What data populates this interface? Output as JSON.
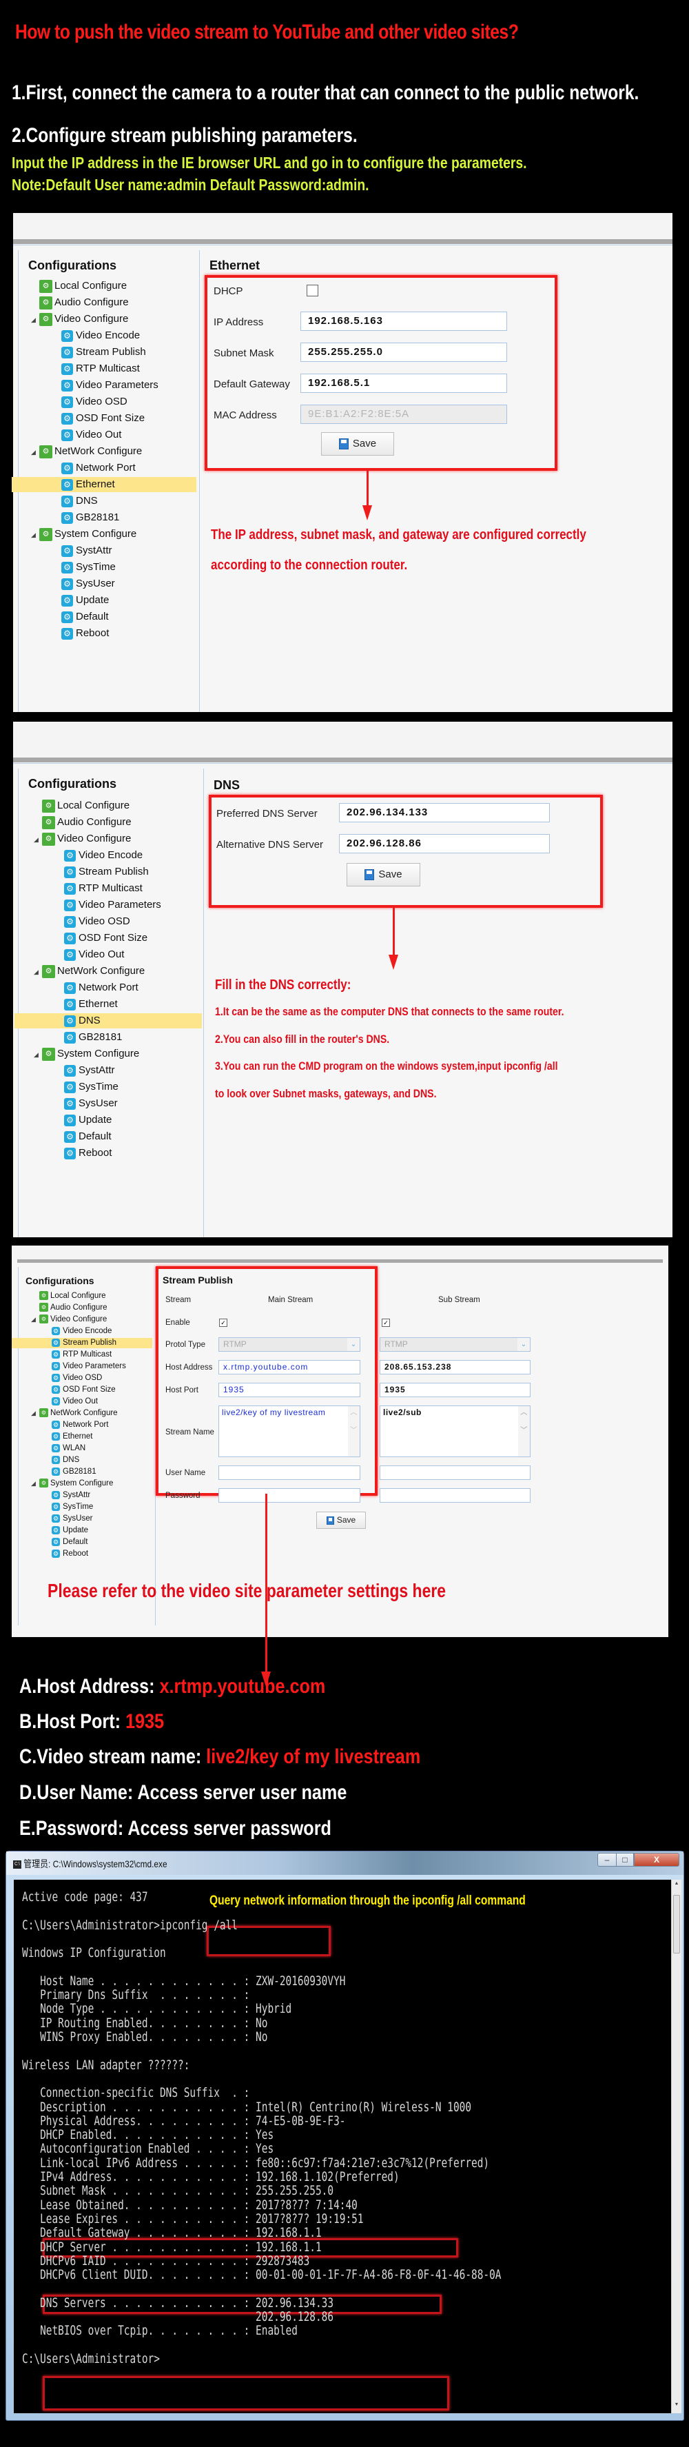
{
  "header": {
    "title": "How to push the video stream to YouTube and other video sites?",
    "step1": "1.First, connect the camera to a router that can connect to the public network.",
    "step2": "2.Configure stream publishing parameters.",
    "note1": "Input  the IP address in the IE browser URL and go in to configure the parameters.",
    "note2": "Note:Default User name:admin  Default Password:admin."
  },
  "sidebar_title": "Configurations",
  "tree_common": {
    "local": "Local Configure",
    "audio": "Audio Configure",
    "video": "Video Configure",
    "video_children": [
      "Video Encode",
      "Stream Publish",
      "RTP Multicast",
      "Video Parameters",
      "Video OSD",
      "OSD Font Size",
      "Video Out"
    ],
    "network": "NetWork Configure",
    "system": "System Configure",
    "system_children": [
      "SystAttr",
      "SysTime",
      "SysUser",
      "Update",
      "Default",
      "Reboot"
    ]
  },
  "panel1": {
    "network_children": [
      "Network Port",
      "Ethernet",
      "DNS",
      "GB28181"
    ],
    "selected": "Ethernet",
    "heading": "Ethernet",
    "fields": {
      "dhcp_label": "DHCP",
      "dhcp_checked": false,
      "ip_label": "IP Address",
      "ip_value": "192.168.5.163",
      "mask_label": "Subnet Mask",
      "mask_value": "255.255.255.0",
      "gateway_label": "Default Gateway",
      "gateway_value": "192.168.5.1",
      "mac_label": "MAC Address",
      "mac_value": "9E:B1:A2:F2:8E:5A"
    },
    "save_label": "Save",
    "annotation": [
      "The IP address, subnet mask, and gateway are configured correctly",
      "according to the connection router."
    ]
  },
  "panel2": {
    "network_children": [
      "Network Port",
      "Ethernet",
      "DNS",
      "GB28181"
    ],
    "selected": "DNS",
    "heading": "DNS",
    "preferred_label": "Preferred DNS Server",
    "preferred_value": "202.96.134.133",
    "alternative_label": "Alternative DNS Server",
    "alternative_value": "202.96.128.86",
    "save_label": "Save",
    "annotation_title": "Fill in the DNS correctly:",
    "annotation_lines": [
      "1.It can be the same as the computer DNS that connects to the same router.",
      "2.You can also fill in the router's DNS.",
      "3.You can run the CMD program on the windows system,input ipconfig /all",
      "to look over Subnet masks, gateways, and DNS."
    ]
  },
  "panel3": {
    "network_children": [
      "Network Port",
      "Ethernet",
      "WLAN",
      "DNS",
      "GB28181"
    ],
    "selected": "Stream Publish",
    "heading": "Stream Publish",
    "col_stream": "Stream",
    "col_main": "Main Stream",
    "col_sub": "Sub Stream",
    "enable_label": "Enable",
    "main_enabled": true,
    "sub_enabled": true,
    "protocol_label": "Protol Type",
    "main_protocol": "RTMP",
    "sub_protocol": "RTMP",
    "host_label": "Host Address",
    "main_host": "x.rtmp.youtube.com",
    "sub_host": "208.65.153.238",
    "port_label": "Host Port",
    "main_port": "1935",
    "sub_port": "1935",
    "stream_name_label": "Stream Name",
    "main_stream_name": "live2/key of my livestream",
    "sub_stream_name": "live2/sub",
    "user_label": "User Name",
    "main_user": "",
    "sub_user": "",
    "password_label": "Password",
    "main_password": "",
    "sub_password": "",
    "save_label": "Save",
    "annotation": "Please refer to the video site parameter settings here"
  },
  "summary": [
    {
      "label": "A.Host Address: ",
      "value": "x.rtmp.youtube.com"
    },
    {
      "label": "B.Host Port: ",
      "value": "1935"
    },
    {
      "label": "C.Video stream name: ",
      "value": "live2/key of my livestream"
    },
    {
      "label": "D.User Name: Access server user name",
      "value": ""
    },
    {
      "label": "E.Password: Access server password",
      "value": ""
    }
  ],
  "cmd": {
    "window_title": "管理员: C:\\Windows\\system32\\cmd.exe",
    "note": "Query network information through the ipconfig /all command",
    "lines": [
      "Active code page: 437",
      "",
      "C:\\Users\\Administrator>ipconfig /all",
      "",
      "Windows IP Configuration",
      "",
      "   Host Name . . . . . . . . . . . . : ZXW-20160930VYH",
      "   Primary Dns Suffix  . . . . . . . :",
      "   Node Type . . . . . . . . . . . . : Hybrid",
      "   IP Routing Enabled. . . . . . . . : No",
      "   WINS Proxy Enabled. . . . . . . . : No",
      "",
      "Wireless LAN adapter ??????:",
      "",
      "   Connection-specific DNS Suffix  . :",
      "   Description . . . . . . . . . . . : Intel(R) Centrino(R) Wireless-N 1000",
      "   Physical Address. . . . . . . . . : 74-E5-0B-9E-F3-",
      "   DHCP Enabled. . . . . . . . . . . : Yes",
      "   Autoconfiguration Enabled . . . . : Yes",
      "   Link-local IPv6 Address . . . . . : fe80::6c97:f7a4:21e7:e3c7%12(Preferred)",
      "   IPv4 Address. . . . . . . . . . . : 192.168.1.102(Preferred)",
      "   Subnet Mask . . . . . . . . . . . : 255.255.255.0",
      "   Lease Obtained. . . . . . . . . . : 2017?8?7? 7:14:40",
      "   Lease Expires . . . . . . . . . . : 2017?8?7? 19:19:51",
      "   Default Gateway . . . . . . . . . : 192.168.1.1",
      "   DHCP Server . . . . . . . . . . . : 192.168.1.1",
      "   DHCPv6 IAID . . . . . . . . . . . : 292873483",
      "   DHCPv6 Client DUID. . . . . . . . : 00-01-00-01-1F-7F-A4-86-F8-0F-41-46-88-0A",
      "",
      "   DNS Servers . . . . . . . . . . . : 202.96.134.33",
      "                                       202.96.128.86",
      "   NetBIOS over Tcpip. . . . . . . . : Enabled",
      "",
      "C:\\Users\\Administrator>"
    ]
  },
  "colors": {
    "title_red": "#ff1a1a",
    "annotation_red": "#e10d1a",
    "note_green": "#d6f53a",
    "cmd_note_yellow": "#ffee00",
    "selected_highlight": "#fde58b"
  }
}
